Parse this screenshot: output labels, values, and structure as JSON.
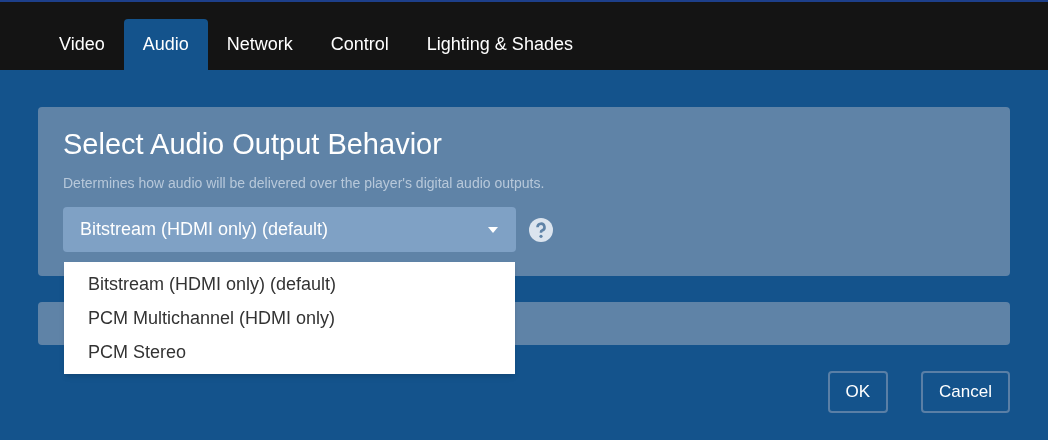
{
  "tabs": [
    {
      "label": "Video",
      "selected": false
    },
    {
      "label": "Audio",
      "selected": true
    },
    {
      "label": "Network",
      "selected": false
    },
    {
      "label": "Control",
      "selected": false
    },
    {
      "label": "Lighting & Shades",
      "selected": false
    }
  ],
  "panel": {
    "title": "Select Audio Output Behavior",
    "description": "Determines how audio will be delivered over the player's digital audio outputs.",
    "dropdown": {
      "value": "Bitstream (HDMI only) (default)",
      "expanded": true,
      "options": [
        "Bitstream (HDMI only) (default)",
        "PCM Multichannel (HDMI only)",
        "PCM Stereo"
      ]
    }
  },
  "buttons": [
    "OK",
    "Cancel"
  ]
}
